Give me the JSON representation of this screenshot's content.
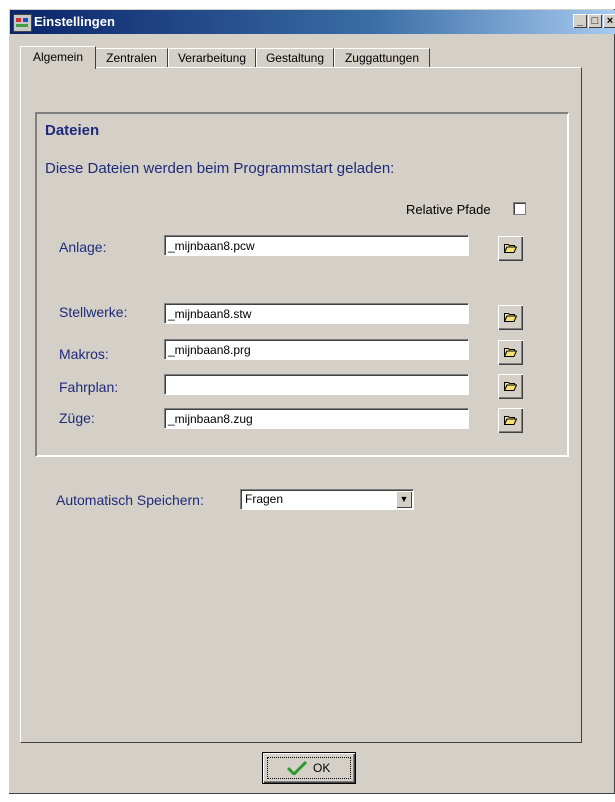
{
  "window": {
    "title": "Einstellingen",
    "controls": {
      "minimize": "_",
      "maximize": "□",
      "close": "×"
    }
  },
  "tabs": [
    {
      "label": "Algemein",
      "active": true
    },
    {
      "label": "Zentralen"
    },
    {
      "label": "Verarbeitung"
    },
    {
      "label": "Gestaltung"
    },
    {
      "label": "Zuggattungen"
    }
  ],
  "files": {
    "group_title": "Dateien",
    "description": "Diese Dateien werden beim Programmstart geladen:",
    "relative_paths_label": "Relative Pfade",
    "relative_paths_checked": false,
    "fields": [
      {
        "label": "Anlage:",
        "value": "_mijnbaan8.pcw"
      },
      {
        "label": "Stellwerke:",
        "value": "_mijnbaan8.stw"
      },
      {
        "label": "Makros:",
        "value": "_mijnbaan8.prg"
      },
      {
        "label": "Fahrplan:",
        "value": ""
      },
      {
        "label": "Züge:",
        "value": "_mijnbaan8.zug"
      }
    ]
  },
  "autosave": {
    "label": "Automatisch Speichern:",
    "selected": "Fragen"
  },
  "ok_button": {
    "label": "OK"
  },
  "colors": {
    "title_bar": "#0a246a",
    "label_text": "#1f2a7a",
    "face": "#d4d0c8",
    "check_green": "#2f9a2f",
    "folder_yellow": "#f7e27a"
  },
  "icons": [
    "app-icon",
    "folder-open-icon",
    "checkmark-icon",
    "dropdown-arrow-icon"
  ]
}
